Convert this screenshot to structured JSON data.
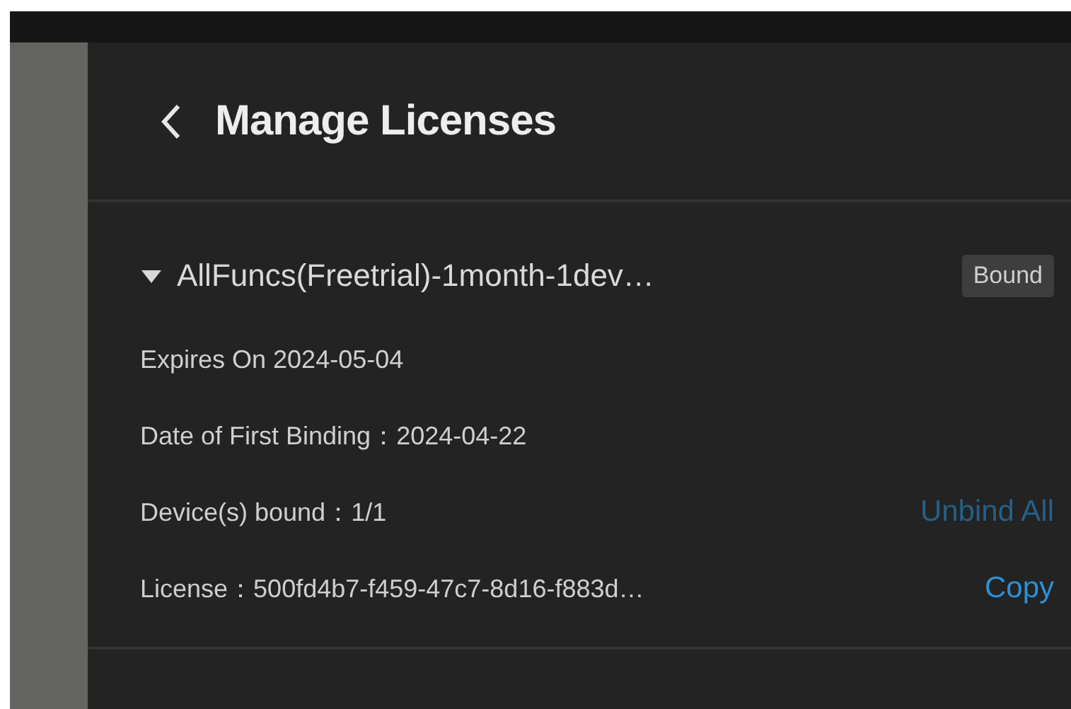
{
  "header": {
    "title": "Manage Licenses"
  },
  "licenses": [
    {
      "name": "AllFuncs(Freetrial)-1month-1dev…",
      "expanded": true,
      "badge": "Bound",
      "expires": "Expires On 2024-05-04",
      "first_binding": "Date of First Binding：2024-04-22",
      "devices": "Device(s) bound：1/1",
      "unbind": {
        "label": "Unbind All",
        "disabled": true
      },
      "license": "License：500fd4b7-f459-47c7-8d16-f883d…",
      "copy": {
        "label": "Copy",
        "disabled": false
      }
    }
  ]
}
